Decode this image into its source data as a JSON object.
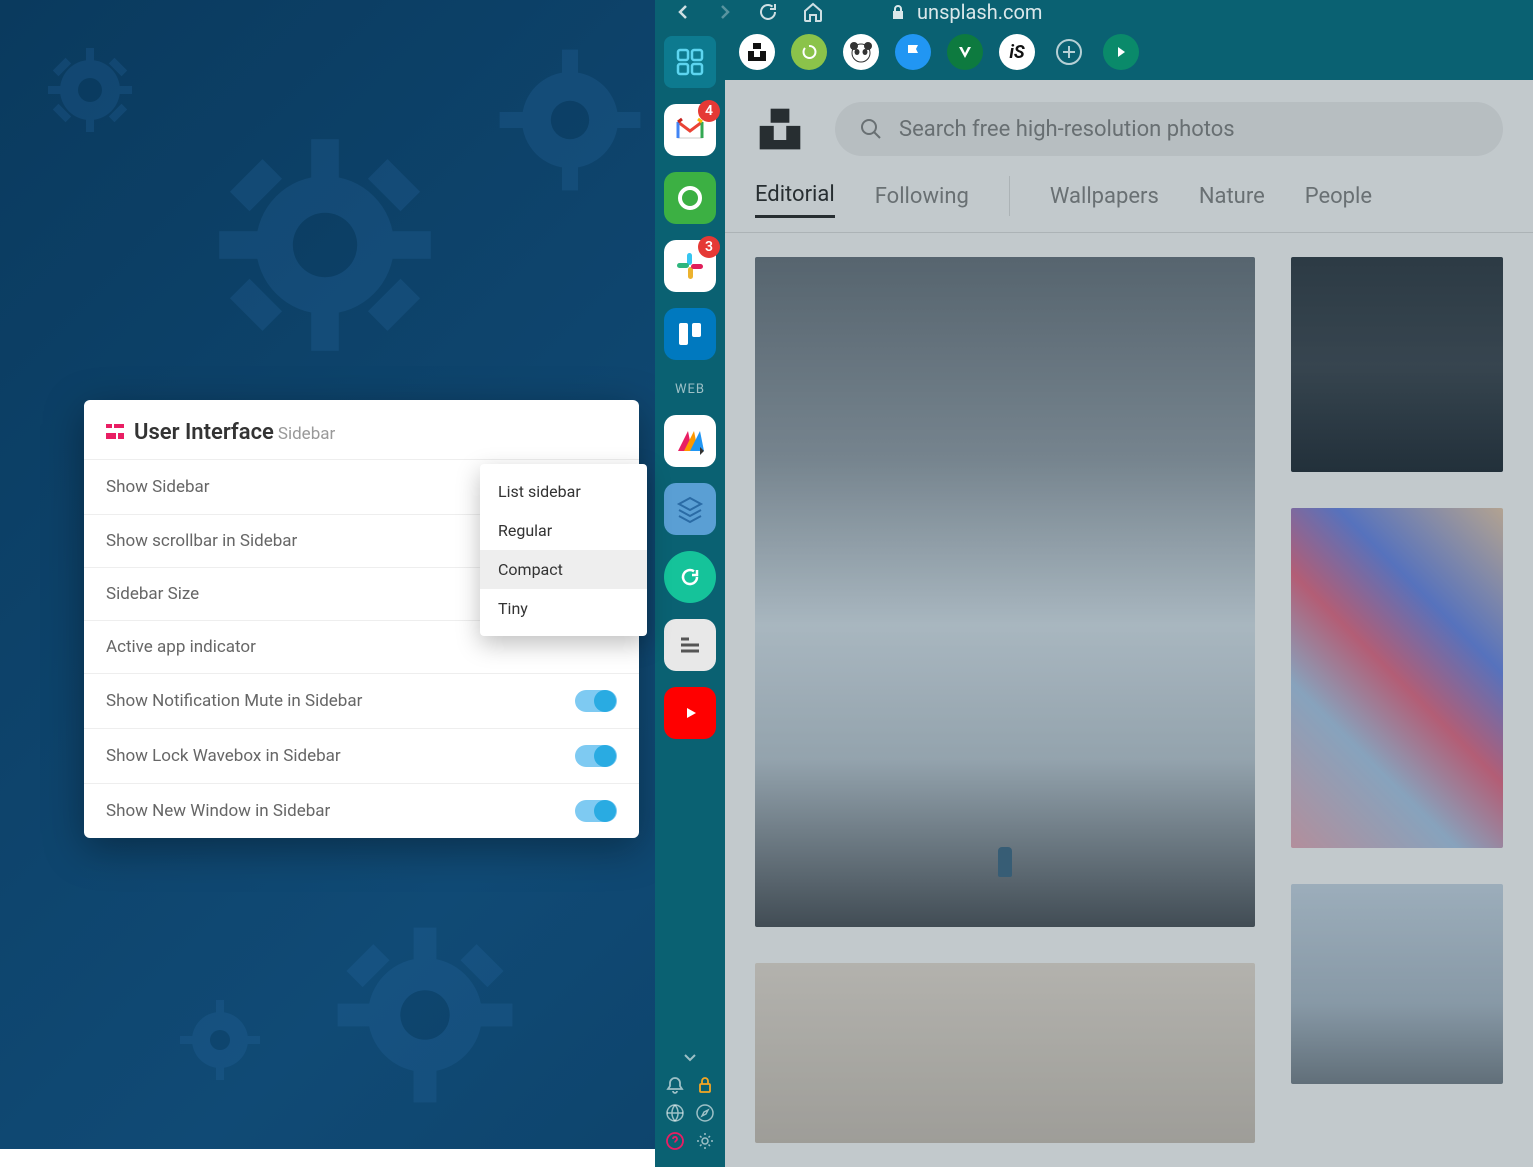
{
  "settings": {
    "title": "User Interface",
    "subtitle": "Sidebar",
    "rows": [
      {
        "label": "Show Sidebar",
        "toggle": true
      },
      {
        "label": "Show scrollbar in Sidebar",
        "toggle": false
      },
      {
        "label": "Sidebar Size",
        "toggle": false
      },
      {
        "label": "Active app indicator",
        "toggle": false
      },
      {
        "label": "Show Notification Mute in Sidebar",
        "toggle": true
      },
      {
        "label": "Show Lock Wavebox in Sidebar",
        "toggle": true
      },
      {
        "label": "Show New Window in Sidebar",
        "toggle": true
      }
    ],
    "dropdown": {
      "options": [
        "List sidebar",
        "Regular",
        "Compact",
        "Tiny"
      ],
      "selected": "Compact"
    }
  },
  "browser": {
    "url": "unsplash.com"
  },
  "sidebar": {
    "gmail_badge": "4",
    "slack_badge": "3",
    "web_label": "WEB"
  },
  "site": {
    "search_placeholder": "Search free high-resolution photos",
    "tabs": [
      "Editorial",
      "Following"
    ],
    "tabs_right": [
      "Wallpapers",
      "Nature",
      "People"
    ],
    "active_tab": "Editorial"
  }
}
